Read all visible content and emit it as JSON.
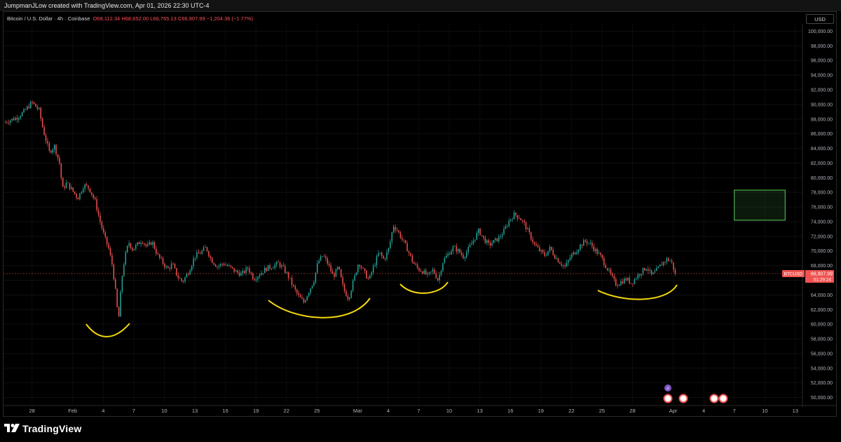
{
  "header": {
    "caption": "JumpmanJLow created with TradingView.com, Apr 01, 2026 22:30 UTC-4"
  },
  "legend": {
    "symbol": "Bitcoin / U.S. Dollar · 4h · Coinbase",
    "open": "O68,112.34",
    "high": "H68,652.00",
    "low": "L66,765.13",
    "close": "C66,907.99",
    "change": "−1,204.36 (−1.77%)"
  },
  "currency_button": "USD",
  "price_tag": {
    "symbol": "BTCUSD",
    "price": "66,907.99",
    "countdown": "01:29:24"
  },
  "brand": {
    "name": "TradingView"
  },
  "colors": {
    "up": "#26a69a",
    "down": "#ef5350",
    "background": "#000000",
    "annotation": "#f5d90a",
    "zone": "#4caf50"
  },
  "chart_data": {
    "type": "candlestick",
    "symbol": "BTCUSD",
    "interval": "4h",
    "ylim": [
      49000,
      101000
    ],
    "y_ticks": [
      "100,000.00",
      "98,000.00",
      "96,000.00",
      "94,000.00",
      "92,000.00",
      "90,000.00",
      "88,000.00",
      "86,000.00",
      "84,000.00",
      "82,000.00",
      "80,000.00",
      "78,000.00",
      "76,000.00",
      "74,000.00",
      "72,000.00",
      "70,000.00",
      "68,000.00",
      "66,000.00",
      "64,000.00",
      "62,000.00",
      "60,000.00",
      "58,000.00",
      "56,000.00",
      "54,000.00",
      "52,000.00",
      "50,000.00"
    ],
    "y_tick_values": [
      100000,
      98000,
      96000,
      94000,
      92000,
      90000,
      88000,
      86000,
      84000,
      82000,
      80000,
      78000,
      76000,
      74000,
      72000,
      70000,
      68000,
      66000,
      64000,
      62000,
      60000,
      58000,
      56000,
      54000,
      52000,
      50000
    ],
    "x_ticks": [
      "28",
      "Feb",
      "4",
      "7",
      "10",
      "13",
      "16",
      "19",
      "22",
      "25",
      "Mar",
      "4",
      "7",
      "10",
      "13",
      "16",
      "19",
      "22",
      "25",
      "28",
      "Apr",
      "4",
      "7",
      "10",
      "13"
    ],
    "x_tick_days": [
      -4,
      0,
      3,
      6,
      9,
      12,
      15,
      18,
      21,
      24,
      28,
      31,
      34,
      37,
      40,
      43,
      46,
      49,
      52,
      55,
      59,
      62,
      65,
      68,
      71
    ],
    "day_range": [
      -6.8,
      71.7
    ],
    "last_price": 66907.99,
    "price_path": [
      [
        -6.8,
        87500
      ],
      [
        -5.5,
        88200
      ],
      [
        -4.8,
        89000
      ],
      [
        -4.0,
        90300
      ],
      [
        -3.3,
        89200
      ],
      [
        -2.9,
        86500
      ],
      [
        -2.3,
        83500
      ],
      [
        -1.8,
        84300
      ],
      [
        -1.3,
        82000
      ],
      [
        -1.0,
        78400
      ],
      [
        -0.6,
        79300
      ],
      [
        0,
        78200
      ],
      [
        0.5,
        77200
      ],
      [
        1.1,
        79000
      ],
      [
        1.6,
        78600
      ],
      [
        2.2,
        76800
      ],
      [
        2.6,
        74500
      ],
      [
        3.1,
        72000
      ],
      [
        3.5,
        70500
      ],
      [
        3.9,
        68000
      ],
      [
        4.2,
        64500
      ],
      [
        4.5,
        60400
      ],
      [
        4.8,
        66000
      ],
      [
        5.1,
        69000
      ],
      [
        5.5,
        71200
      ],
      [
        5.9,
        70200
      ],
      [
        6.3,
        70800
      ],
      [
        6.8,
        71500
      ],
      [
        7.3,
        70500
      ],
      [
        7.8,
        71300
      ],
      [
        8.3,
        69500
      ],
      [
        8.8,
        68500
      ],
      [
        9.3,
        67500
      ],
      [
        9.8,
        68200
      ],
      [
        10.3,
        66500
      ],
      [
        10.8,
        65800
      ],
      [
        11.4,
        67200
      ],
      [
        12.0,
        69300
      ],
      [
        12.6,
        69800
      ],
      [
        13.1,
        70500
      ],
      [
        13.6,
        68800
      ],
      [
        14.2,
        67900
      ],
      [
        14.8,
        68300
      ],
      [
        15.4,
        67800
      ],
      [
        16.0,
        67200
      ],
      [
        16.6,
        66800
      ],
      [
        17.2,
        67700
      ],
      [
        17.8,
        66200
      ],
      [
        18.4,
        66900
      ],
      [
        19.0,
        67600
      ],
      [
        19.6,
        67900
      ],
      [
        20.2,
        68300
      ],
      [
        20.7,
        67600
      ],
      [
        21.2,
        66500
      ],
      [
        21.7,
        65000
      ],
      [
        22.2,
        63800
      ],
      [
        22.7,
        63000
      ],
      [
        23.2,
        64500
      ],
      [
        23.7,
        66000
      ],
      [
        24.1,
        68500
      ],
      [
        24.6,
        69400
      ],
      [
        25.1,
        68200
      ],
      [
        25.6,
        66500
      ],
      [
        26.1,
        67800
      ],
      [
        26.6,
        64800
      ],
      [
        27.1,
        63500
      ],
      [
        27.6,
        66000
      ],
      [
        28.1,
        68500
      ],
      [
        28.6,
        67200
      ],
      [
        29.1,
        66000
      ],
      [
        29.6,
        68000
      ],
      [
        30.1,
        69800
      ],
      [
        30.6,
        68800
      ],
      [
        31.1,
        70500
      ],
      [
        31.5,
        73500
      ],
      [
        31.9,
        72800
      ],
      [
        32.4,
        71500
      ],
      [
        32.9,
        70200
      ],
      [
        33.4,
        68500
      ],
      [
        33.9,
        67600
      ],
      [
        34.4,
        67200
      ],
      [
        34.9,
        66600
      ],
      [
        35.4,
        67400
      ],
      [
        35.9,
        66000
      ],
      [
        36.4,
        68700
      ],
      [
        36.9,
        69600
      ],
      [
        37.4,
        70500
      ],
      [
        37.9,
        70000
      ],
      [
        38.4,
        69200
      ],
      [
        38.9,
        70300
      ],
      [
        39.4,
        71500
      ],
      [
        39.9,
        72800
      ],
      [
        40.4,
        71600
      ],
      [
        40.9,
        70800
      ],
      [
        41.4,
        71300
      ],
      [
        41.9,
        71800
      ],
      [
        42.4,
        72800
      ],
      [
        42.9,
        74200
      ],
      [
        43.4,
        75000
      ],
      [
        43.9,
        74600
      ],
      [
        44.4,
        73600
      ],
      [
        44.9,
        72200
      ],
      [
        45.4,
        70800
      ],
      [
        45.9,
        70000
      ],
      [
        46.4,
        69400
      ],
      [
        46.9,
        70400
      ],
      [
        47.4,
        69200
      ],
      [
        47.9,
        68400
      ],
      [
        48.4,
        67800
      ],
      [
        48.9,
        69200
      ],
      [
        49.4,
        69900
      ],
      [
        49.9,
        70800
      ],
      [
        50.4,
        71400
      ],
      [
        50.9,
        70900
      ],
      [
        51.4,
        70000
      ],
      [
        51.9,
        69200
      ],
      [
        52.4,
        67900
      ],
      [
        52.9,
        66600
      ],
      [
        53.4,
        65400
      ],
      [
        53.9,
        65800
      ],
      [
        54.4,
        66200
      ],
      [
        54.9,
        65600
      ],
      [
        55.4,
        66500
      ],
      [
        55.9,
        67200
      ],
      [
        56.4,
        67800
      ],
      [
        56.9,
        66600
      ],
      [
        57.4,
        67400
      ],
      [
        57.9,
        68300
      ],
      [
        58.4,
        68900
      ],
      [
        58.8,
        68600
      ],
      [
        59.2,
        66908
      ]
    ],
    "zone": {
      "day_from": 65.0,
      "day_to": 70.0,
      "price_from": 74200,
      "price_to": 78300
    }
  }
}
